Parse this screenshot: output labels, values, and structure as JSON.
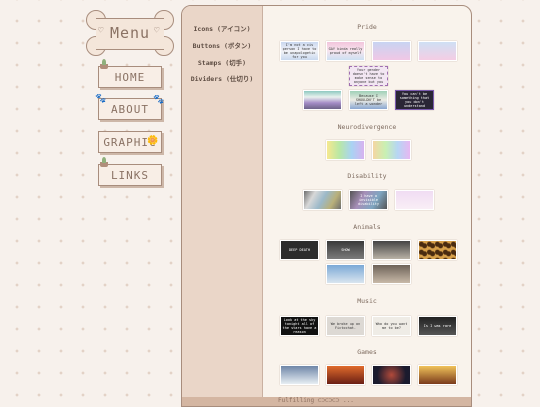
{
  "menu": {
    "title": "Menu",
    "heart": "♡",
    "items": [
      {
        "label": "Home",
        "icon": "pot-plant-icon"
      },
      {
        "label": "About",
        "icon": "paw-print-icon",
        "glyph": "🐾"
      },
      {
        "label": "Graphic",
        "icon": "flower-icon",
        "glyph": "🌼"
      },
      {
        "label": "Links",
        "icon": "pot-plant-icon"
      }
    ]
  },
  "side_nav": {
    "items": [
      "Icons (アイコン)",
      "Buttons (ボタン)",
      "Stamps (切手)",
      "Dividers (仕切り)"
    ]
  },
  "sections": [
    {
      "title": "Pride"
    },
    {
      "title": "Neurodivergence"
    },
    {
      "title": "Disability"
    },
    {
      "title": "Animals"
    },
    {
      "title": "Music"
    },
    {
      "title": "Games"
    }
  ],
  "stamp_texts": {
    "pride_1": "I'm not a cis person I have to be unapologetic for you",
    "pride_2": "GAY kinda really proud of myself",
    "pride_5": "Your gender doesn't have to make sense to anyone but you",
    "pride_7": "Because I SHOULDN'T be left a wonder",
    "pride_8": "You can't be something that you don't understand",
    "disab_2": "I have a invisible disability",
    "animal_1": "DEEP DEATH",
    "animal_2": "SHOW",
    "music_1": "Look at the sky tonight all of the stars have a reason",
    "music_2": "We broke up on Fictochat.",
    "music_3": "Who do you want me to be?",
    "music_4": "Is I was rare"
  },
  "footer_text": "Fulfilling ⊂⊃⊂⊃⊂⊃ ..."
}
